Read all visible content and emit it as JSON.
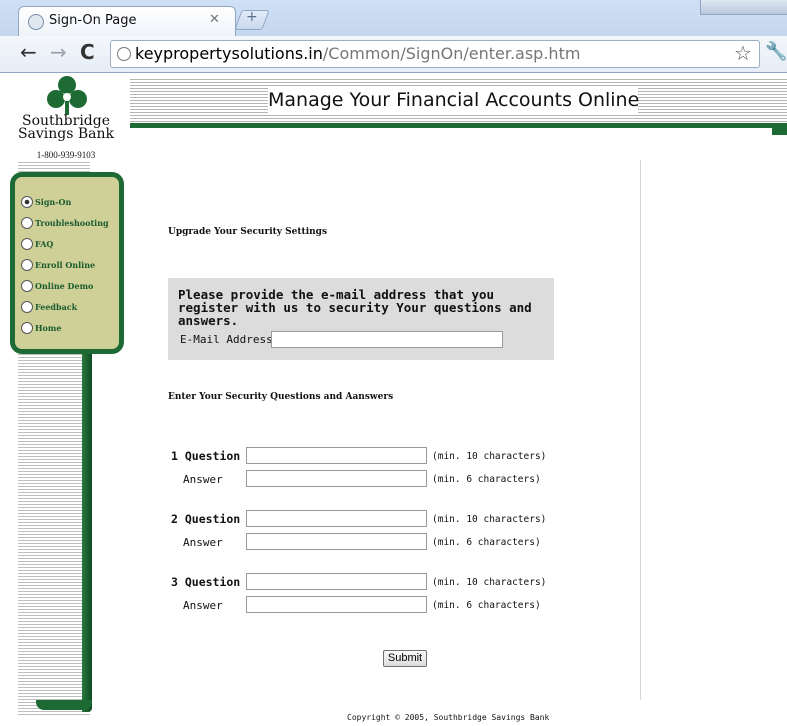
{
  "browser": {
    "tab_title": "Sign-On Page",
    "url_host": "keypropertysolutions.in",
    "url_path": "/Common/SignOn/enter.asp.htm"
  },
  "logo": {
    "name_line1": "Southbridge",
    "name_line2": "Savings Bank",
    "phone": "1-800-939-9103",
    "brand_color": "#1e6a35"
  },
  "header": {
    "title": "Manage Your Financial Accounts Online"
  },
  "sidebar": {
    "items": [
      {
        "label": "Sign-On",
        "active": true
      },
      {
        "label": "Troubleshooting",
        "active": false
      },
      {
        "label": "FAQ",
        "active": false
      },
      {
        "label": "Enroll Online",
        "active": false
      },
      {
        "label": "Online Demo",
        "active": false
      },
      {
        "label": "Feedback",
        "active": false
      },
      {
        "label": "Home",
        "active": false
      }
    ]
  },
  "form": {
    "upgrade_heading": "Upgrade Your Security Settings",
    "email_instructions": "Please provide the e-mail address that you register with us to  security Your questions and answers.",
    "email_label": "E-Mail Address",
    "email_value": "",
    "questions_heading": "Enter Your Security Questions and Aanswers",
    "questions": [
      {
        "question_label": "1 Question",
        "answer_label": "Answer",
        "question_hint": "(min. 10 characters)",
        "answer_hint": "(min. 6 characters)"
      },
      {
        "question_label": "2 Question",
        "answer_label": "Answer",
        "question_hint": "(min. 10 characters)",
        "answer_hint": "(min. 6 characters)"
      },
      {
        "question_label": "3 Question",
        "answer_label": "Answer",
        "question_hint": "(min. 10 characters)",
        "answer_hint": "(min. 6 characters)"
      }
    ],
    "submit_label": "Submit"
  },
  "footer": {
    "copyright": "Copyright © 2005, Southbridge Savings Bank"
  }
}
